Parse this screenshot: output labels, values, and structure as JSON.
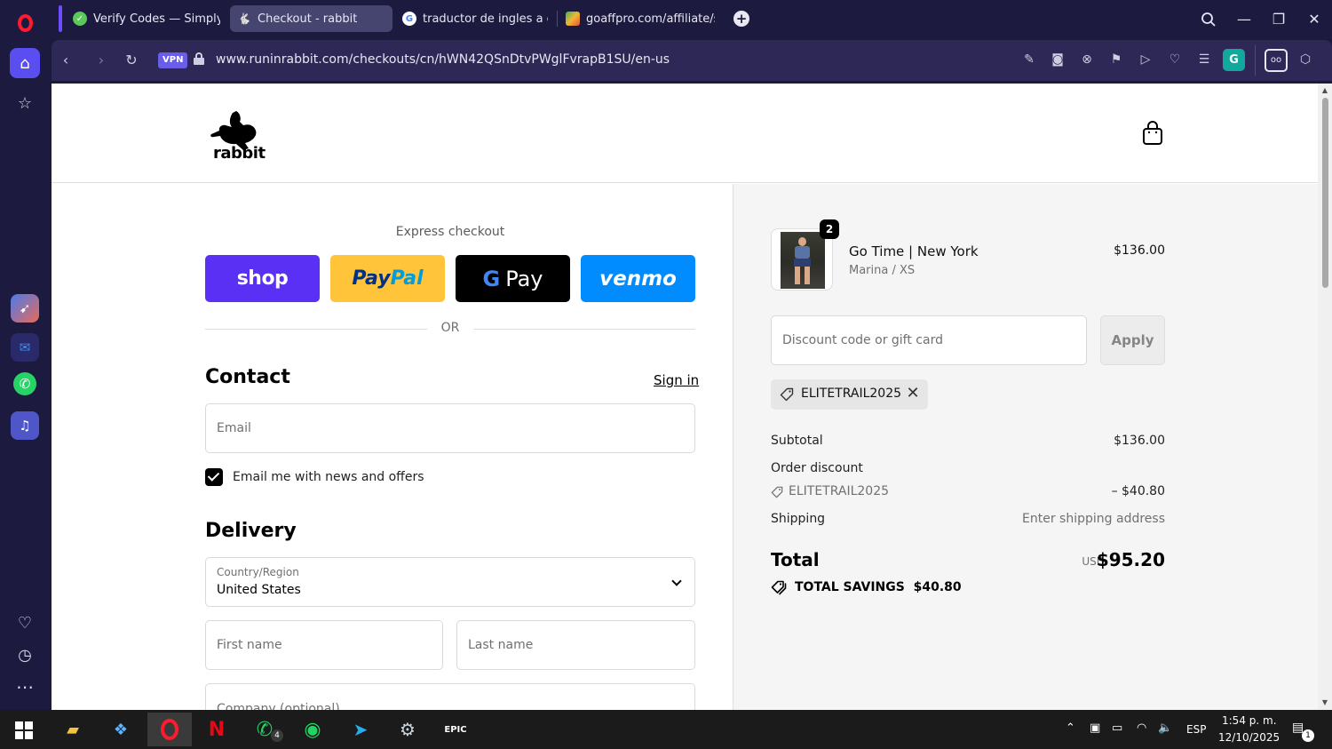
{
  "browser": {
    "tabs": [
      {
        "title": "Verify Codes — SimplyCodes",
        "active": false
      },
      {
        "title": "Checkout - rabbit",
        "active": true
      },
      {
        "title": "traductor de ingles a español",
        "active": false
      },
      {
        "title": "goaffpro.com/affiliate/store",
        "active": false
      }
    ],
    "vpn_label": "VPN",
    "url": "www.runinrabbit.com/checkouts/cn/hWN42QSnDtvPWglFvrapB1SU/en-us",
    "profile_initial": "G"
  },
  "site": {
    "logo_text": "rabbit"
  },
  "checkout": {
    "express_label": "Express checkout",
    "shop_label": "shop",
    "paypal_part1": "Pay",
    "paypal_part2": "Pal",
    "gpay_g": "G",
    "gpay_label": "Pay",
    "venmo_label": "venmo",
    "or_label": "OR",
    "contact_heading": "Contact",
    "sign_in_label": "Sign in",
    "email_placeholder": "Email",
    "newsletter_label": "Email me with news and offers",
    "newsletter_checked": true,
    "delivery_heading": "Delivery",
    "country_label": "Country/Region",
    "country_value": "United States",
    "first_name_placeholder": "First name",
    "last_name_placeholder": "Last name",
    "company_placeholder": "Company (optional)"
  },
  "summary": {
    "item": {
      "quantity": "2",
      "name": "Go Time | New York",
      "variant": "Marina / XS",
      "price": "$136.00"
    },
    "discount_placeholder": "Discount code or gift card",
    "apply_label": "Apply",
    "applied_code": "ELITETRAIL2025",
    "subtotal_label": "Subtotal",
    "subtotal_value": "$136.00",
    "order_discount_label": "Order discount",
    "discount_code": "ELITETRAIL2025",
    "discount_value": "– $40.80",
    "shipping_label": "Shipping",
    "shipping_value": "Enter shipping address",
    "total_label": "Total",
    "total_currency": "USD",
    "total_value": "$95.20",
    "savings_label": "TOTAL SAVINGS",
    "savings_value": "$40.80"
  },
  "taskbar": {
    "whatsapp_badge": "4",
    "language": "ESP",
    "time": "1:54 p. m.",
    "date": "12/10/2025",
    "notification_count": "1"
  },
  "colors": {
    "chrome_bg": "#1d1a3f",
    "toolbar_bg": "#2d2855",
    "accent_purple": "#5b4ef0",
    "shop_purple": "#5a31f4",
    "paypal_yellow": "#ffc439",
    "venmo_blue": "#008cff",
    "summary_bg": "#f5f5f5"
  }
}
